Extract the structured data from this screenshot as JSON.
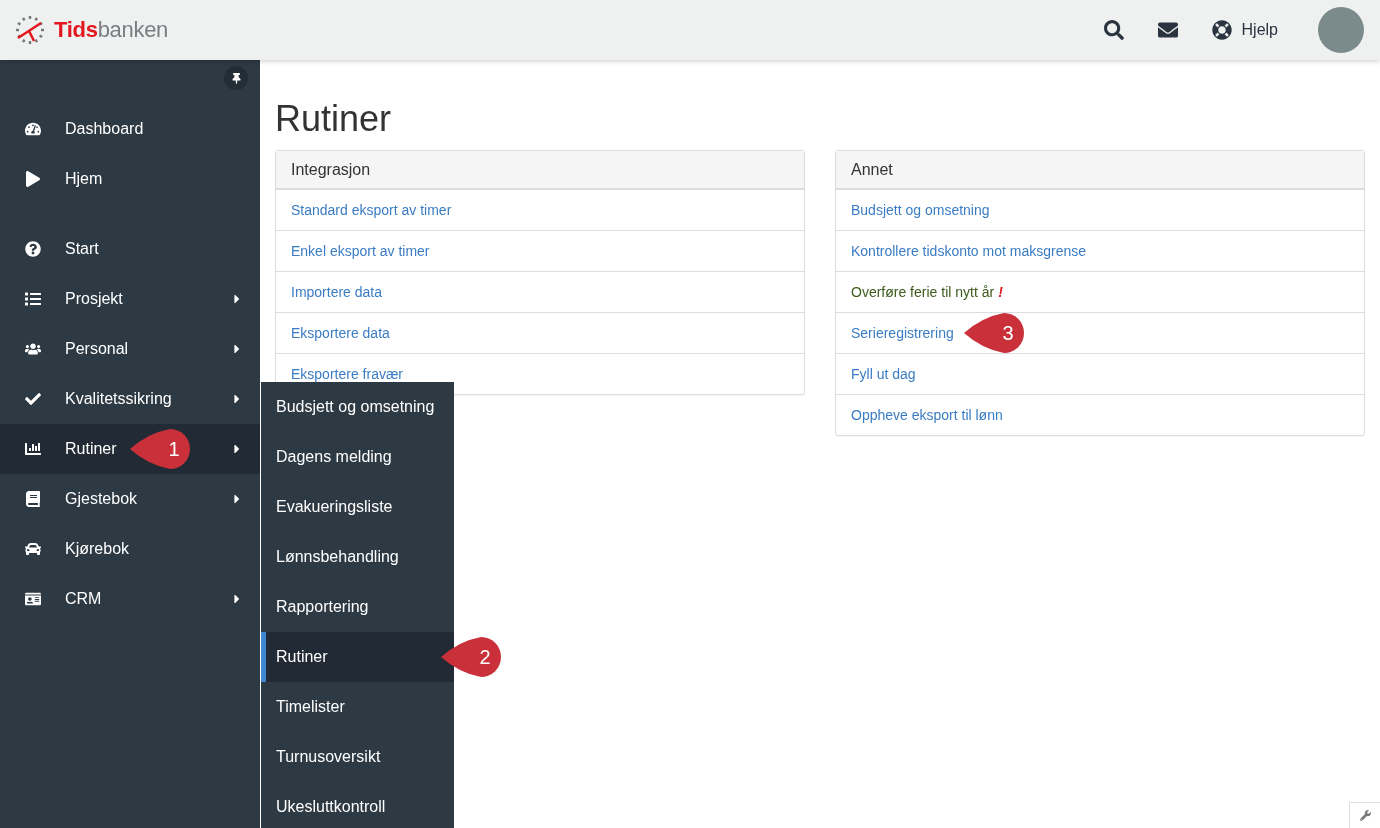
{
  "header": {
    "logo": {
      "first": "Tids",
      "second": "banken"
    },
    "help_label": "Hjelp"
  },
  "sidebar": {
    "groups": [
      [
        {
          "label": "Dashboard",
          "has_submenu": false,
          "selected": false
        },
        {
          "label": "Hjem",
          "has_submenu": false,
          "selected": false
        }
      ],
      [
        {
          "label": "Start",
          "has_submenu": false,
          "selected": false
        },
        {
          "label": "Prosjekt",
          "has_submenu": true,
          "selected": false
        },
        {
          "label": "Personal",
          "has_submenu": true,
          "selected": false
        },
        {
          "label": "Kvalitetssikring",
          "has_submenu": true,
          "selected": false
        },
        {
          "label": "Rutiner",
          "has_submenu": true,
          "selected": true,
          "callout": "1"
        },
        {
          "label": "Gjestebok",
          "has_submenu": true,
          "selected": false
        },
        {
          "label": "Kjørebok",
          "has_submenu": false,
          "selected": false
        },
        {
          "label": "CRM",
          "has_submenu": true,
          "selected": false
        }
      ]
    ]
  },
  "submenu": {
    "items": [
      {
        "label": "Budsjett og omsetning",
        "selected": false
      },
      {
        "label": "Dagens melding",
        "selected": false
      },
      {
        "label": "Evakueringsliste",
        "selected": false
      },
      {
        "label": "Lønnsbehandling",
        "selected": false
      },
      {
        "label": "Rapportering",
        "selected": false
      },
      {
        "label": "Rutiner",
        "selected": true,
        "callout": "2"
      },
      {
        "label": "Timelister",
        "selected": false
      },
      {
        "label": "Turnusoversikt",
        "selected": false
      },
      {
        "label": "Ukesluttkontroll",
        "selected": false
      }
    ]
  },
  "page": {
    "title": "Rutiner",
    "panels": [
      {
        "title": "Integrasjon",
        "items": [
          {
            "label": "Standard eksport av timer",
            "kind": "link"
          },
          {
            "label": "Enkel eksport av timer",
            "kind": "link"
          },
          {
            "label": "Importere data",
            "kind": "link"
          },
          {
            "label": "Eksportere data",
            "kind": "link"
          },
          {
            "label": "Eksportere fravær",
            "kind": "link"
          }
        ]
      },
      {
        "title": "Annet",
        "items": [
          {
            "label": "Budsjett og omsetning",
            "kind": "link"
          },
          {
            "label": "Kontrollere tidskonto mot maksgrense",
            "kind": "link"
          },
          {
            "label": "Overføre ferie til nytt år",
            "kind": "text",
            "flag": "!"
          },
          {
            "label": "Serieregistrering",
            "kind": "link",
            "callout": "3"
          },
          {
            "label": "Fyll ut dag",
            "kind": "link"
          },
          {
            "label": "Oppheve eksport til lønn",
            "kind": "link"
          }
        ]
      }
    ]
  }
}
